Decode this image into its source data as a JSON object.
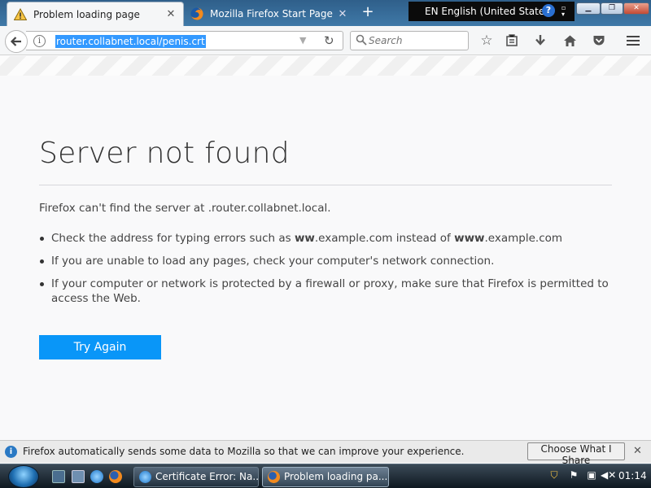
{
  "tabs": [
    {
      "title": "Problem loading page",
      "icon": "warning-icon",
      "active": true
    },
    {
      "title": "Mozilla Firefox Start Page",
      "icon": "firefox-icon",
      "active": false
    }
  ],
  "language_bar": {
    "label": "EN English (United States)",
    "help": "?"
  },
  "url": "router.collabnet.local/penis.crt",
  "search": {
    "placeholder": "Search"
  },
  "error": {
    "title": "Server not found",
    "description": "Firefox can't find the server at .router.collabnet.local.",
    "suggestions": {
      "s1": {
        "pre": "Check the address for typing errors such as ",
        "b1": "ww",
        "mid": ".example.com instead of ",
        "b2": "www",
        "post": ".example.com"
      },
      "s2": "If you are unable to load any pages, check your computer's network connection.",
      "s3": "If your computer or network is protected by a firewall or proxy, make sure that Firefox is permitted to access the Web."
    },
    "try_again": "Try Again"
  },
  "notification": {
    "text": "Firefox automatically sends some data to Mozilla so that we can improve your experience.",
    "button": "Choose What I Share"
  },
  "taskbar": {
    "buttons": [
      {
        "label": "Certificate Error: Na...",
        "icon": "internet-explorer-icon"
      },
      {
        "label": "Problem loading pa...",
        "icon": "firefox-icon"
      }
    ],
    "clock": "01:14"
  },
  "colors": {
    "accent": "#0996f8",
    "url_selection": "#3399ff"
  }
}
